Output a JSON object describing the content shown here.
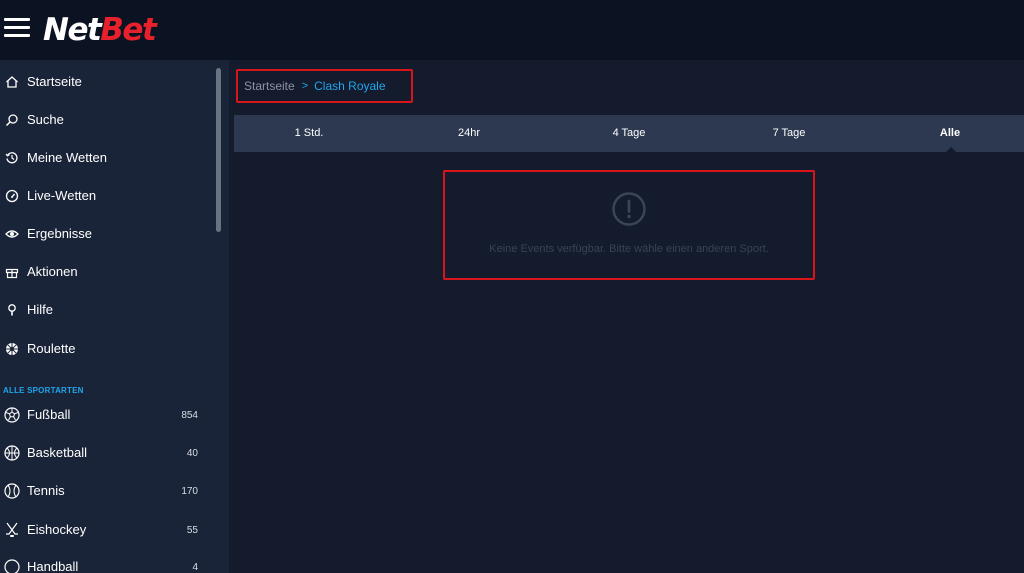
{
  "header": {
    "logo_part1": "Net",
    "logo_part2": "Bet"
  },
  "sidebar": {
    "menu": [
      {
        "label": "Startseite",
        "icon": "home-icon"
      },
      {
        "label": "Suche",
        "icon": "search-icon"
      },
      {
        "label": "Meine Wetten",
        "icon": "history-icon"
      },
      {
        "label": "Live-Wetten",
        "icon": "speedometer-icon"
      },
      {
        "label": "Ergebnisse",
        "icon": "eye-icon"
      },
      {
        "label": "Aktionen",
        "icon": "gift-icon"
      },
      {
        "label": "Hilfe",
        "icon": "lightbulb-icon"
      },
      {
        "label": "Roulette",
        "icon": "roulette-icon"
      }
    ],
    "sports_heading": "ALLE SPORTARTEN",
    "sports": [
      {
        "label": "Fußball",
        "count": "854",
        "icon": "football-icon"
      },
      {
        "label": "Basketball",
        "count": "40",
        "icon": "basketball-icon"
      },
      {
        "label": "Tennis",
        "count": "170",
        "icon": "tennis-icon"
      },
      {
        "label": "Eishockey",
        "count": "55",
        "icon": "hockey-icon"
      },
      {
        "label": "Handball",
        "count": "4",
        "icon": "handball-icon"
      }
    ]
  },
  "breadcrumb": {
    "home": "Startseite",
    "separator": ">",
    "current": "Clash Royale"
  },
  "tabs": [
    {
      "label": "1 Std."
    },
    {
      "label": "24hr"
    },
    {
      "label": "4 Tage"
    },
    {
      "label": "7 Tage"
    },
    {
      "label": "Alle",
      "active": true
    }
  ],
  "empty_state": {
    "message": "Keine Events verfügbar. Bitte wähle einen anderen Sport.",
    "icon": "exclamation-circle-icon"
  },
  "colors": {
    "accent": "#21a5ec",
    "brand_red": "#e8202c",
    "highlight_border": "#d9151b"
  }
}
